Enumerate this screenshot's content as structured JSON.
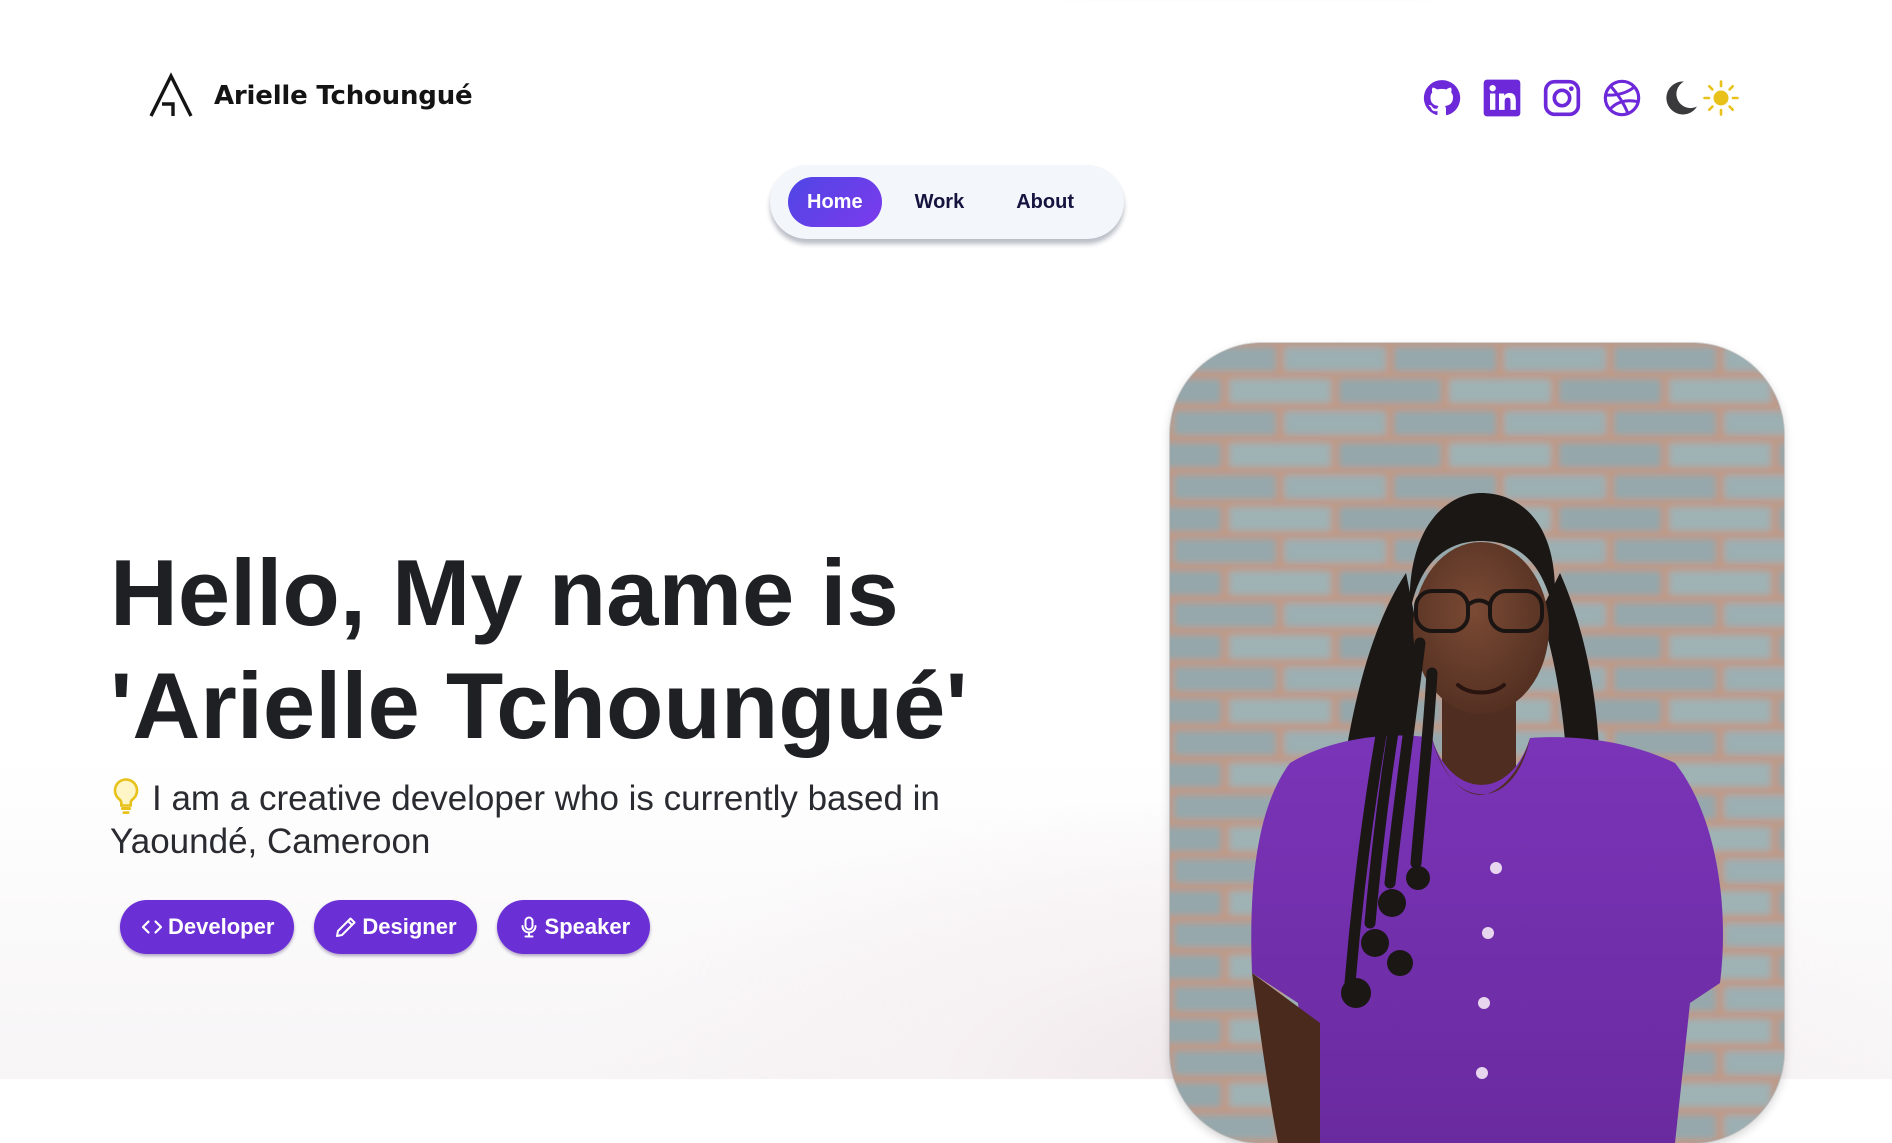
{
  "header": {
    "brand_name": "Arielle Tchoungué",
    "logo_icon": "letter-a-logo",
    "socials": [
      {
        "name": "github-icon",
        "color": "#6d28d9"
      },
      {
        "name": "linkedin-icon",
        "color": "#6d28d9"
      },
      {
        "name": "instagram-icon",
        "color": "#6d28d9"
      },
      {
        "name": "dribbble-icon",
        "color": "#6d28d9"
      }
    ],
    "theme_toggle": {
      "moon_icon": "moon-icon",
      "sun_icon": "sun-icon",
      "sun_color": "#e8c21b"
    }
  },
  "nav": {
    "items": [
      {
        "label": "Home",
        "active": true
      },
      {
        "label": "Work",
        "active": false
      },
      {
        "label": "About",
        "active": false
      }
    ],
    "accent": "#5b3de8"
  },
  "hero": {
    "title_line1": "Hello, My name is",
    "title_line2": "'Arielle Tchoungué'",
    "intro_icon": "lightbulb-icon",
    "intro": "I am a creative developer who is currently based in Yaoundé, Cameroon",
    "tags": [
      {
        "label": "Developer",
        "icon": "code-icon"
      },
      {
        "label": "Designer",
        "icon": "pencil-icon"
      },
      {
        "label": "Speaker",
        "icon": "microphone-icon"
      }
    ],
    "tag_color": "#6b2fd6"
  },
  "portrait": {
    "subject": "portrait-photo"
  }
}
